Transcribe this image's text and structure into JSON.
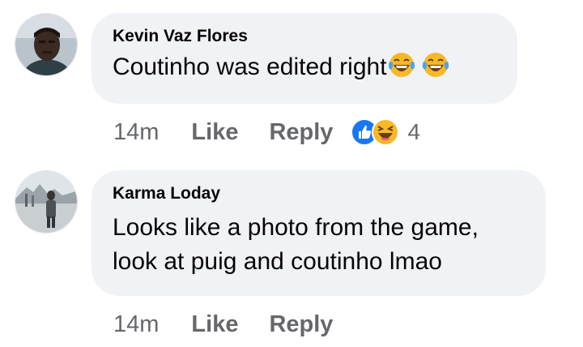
{
  "comments": [
    {
      "author": "Kevin Vaz Flores",
      "text": "Coutinho was edited right",
      "emoji_icons": [
        "laughing-tears-emoji",
        "laughing-tears-emoji"
      ],
      "time": "14m",
      "like_label": "Like",
      "reply_label": "Reply",
      "reactions": {
        "icons": [
          "like-reaction-icon",
          "haha-reaction-icon"
        ],
        "count": "4"
      }
    },
    {
      "author": "Karma Loday",
      "text_lines": [
        "Looks like a photo from the game,",
        "look at puig  and coutinho  lmao"
      ],
      "time": "14m",
      "like_label": "Like",
      "reply_label": "Reply"
    }
  ],
  "colors": {
    "bubble": "#f0f2f5",
    "text": "#050505",
    "meta": "#65676b",
    "like_blue": "#1877f2",
    "haha_yellow": "#f7b928"
  }
}
